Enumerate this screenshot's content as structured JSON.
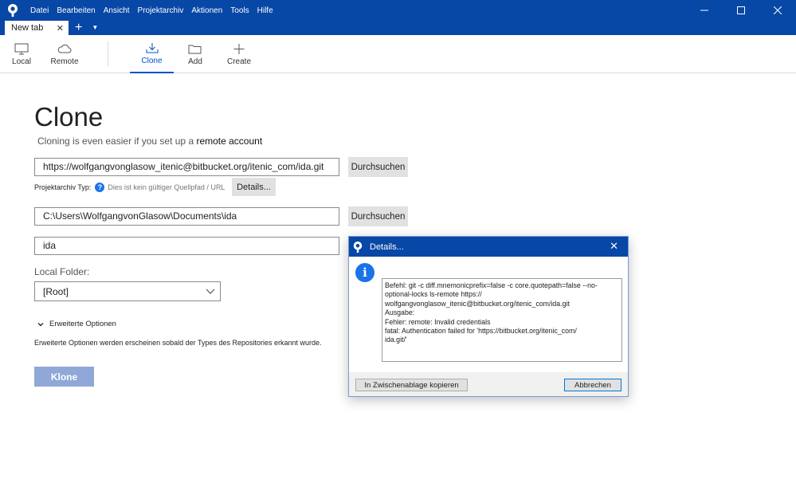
{
  "menu": [
    "Datei",
    "Bearbeiten",
    "Ansicht",
    "Projektarchiv",
    "Aktionen",
    "Tools",
    "Hilfe"
  ],
  "tabs": {
    "active_label": "New tab",
    "close": "✕",
    "add": "+",
    "dropdown": "▼"
  },
  "toolbar": {
    "local": "Local",
    "remote": "Remote",
    "clone": "Clone",
    "add": "Add",
    "create": "Create"
  },
  "clone": {
    "title": "Clone",
    "subtitle_prefix": "Cloning is even easier if you set up a ",
    "subtitle_link": "remote account",
    "source_url": "https://wolfgangvonglasow_itenic@bitbucket.org/itenic_com/ida.git",
    "browse_label": "Durchsuchen",
    "repo_type_label": "Projektarchiv Typ:",
    "repo_type_hint": "Dies ist kein gültiger Quellpfad / URL",
    "details_label": "Details...",
    "destination_path": "C:\\Users\\WolfgangvonGlasow\\Documents\\ida",
    "name": "ida",
    "local_folder_label": "Local Folder:",
    "local_folder_value": "[Root]",
    "advanced_label": "Erweiterte Optionen",
    "advanced_text": "Erweiterte Optionen werden erscheinen sobald der Types des Repositories erkannt wurde.",
    "clone_button": "Klone"
  },
  "dialog": {
    "title": "Details...",
    "close": "✕",
    "info": "i",
    "log": "Befehl: git -c diff.mnemonicprefix=false -c core.quotepath=false --no-optional-locks ls-remote https://\nwolfgangvonglasow_itenic@bitbucket.org/itenic_com/ida.git\nAusgabe:\nFehler: remote: Invalid credentials\nfatal: Authentication failed for 'https://bitbucket.org/itenic_com/\nida.git/'",
    "copy_button": "In Zwischenablage kopieren",
    "cancel_button": "Abbrechen"
  },
  "colors": {
    "brand": "#0747a6",
    "accent": "#0052cc",
    "clone_disabled": "#8fa8d8"
  }
}
